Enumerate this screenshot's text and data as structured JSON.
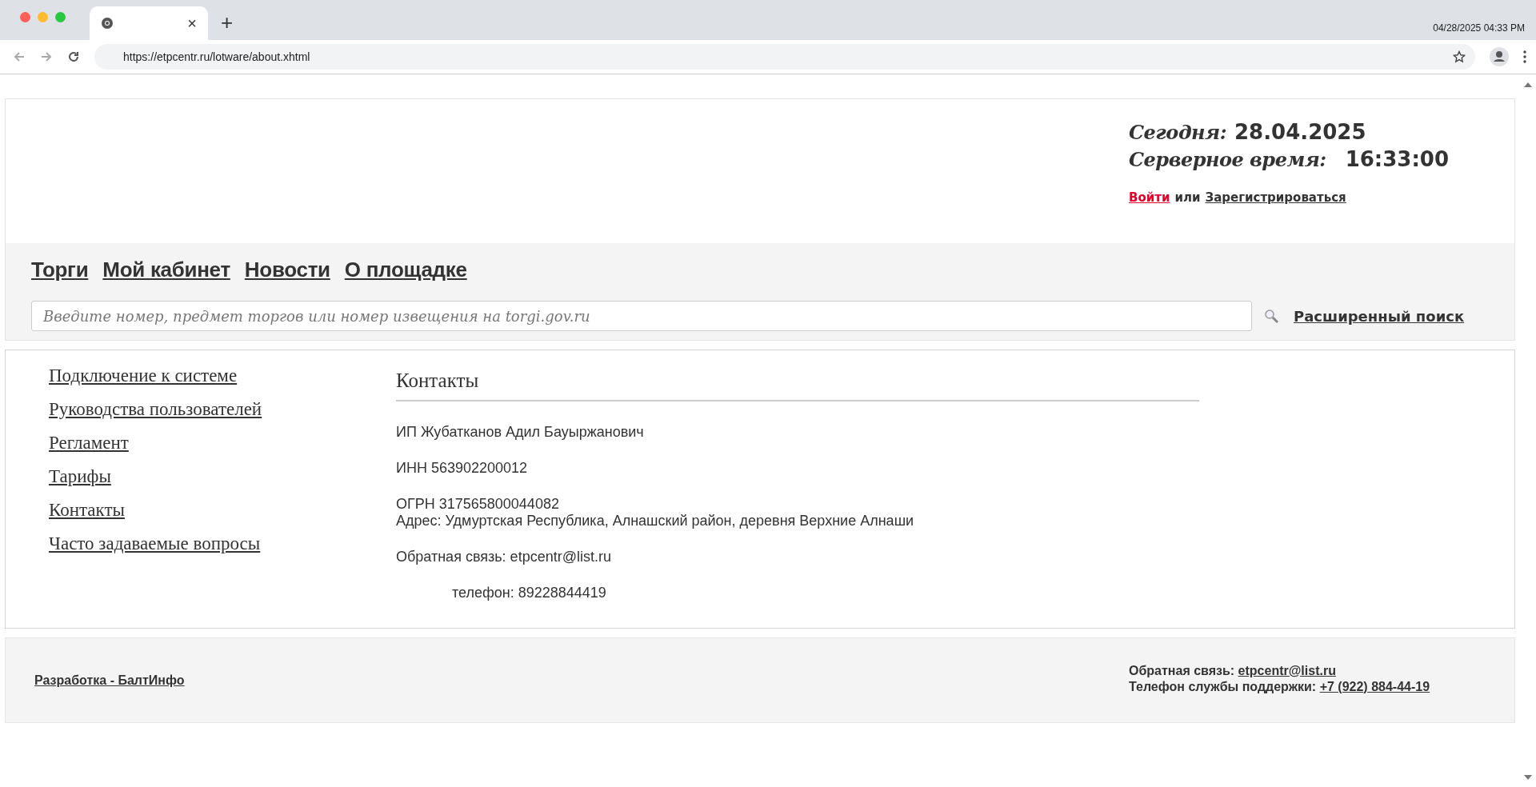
{
  "browser": {
    "tab_close": "×",
    "new_tab": "+",
    "timestamp": "04/28/2025 04:33 PM",
    "url": "https://etpcentr.ru/lotware/about.xhtml"
  },
  "header": {
    "today_label": "Сегодня:",
    "today_value": "28.04.2025",
    "time_label": "Серверное время:",
    "time_value": "16:33:00",
    "login": "Войти",
    "or": "или",
    "register": "Зарегистрироваться"
  },
  "nav": [
    "Торги",
    "Мой кабинет",
    "Новости",
    "О площадке"
  ],
  "search": {
    "placeholder": "Введите номер, предмет торгов или номер извещения на torgi.gov.ru",
    "advanced": "Расширенный поиск"
  },
  "sidebar": [
    "Подключение к системе",
    "Руководства пользователей",
    "Регламент",
    "Тарифы",
    "Контакты",
    "Часто задаваемые вопросы"
  ],
  "content": {
    "title": "Контакты",
    "paragraphs": [
      {
        "kind": "plain",
        "lines": [
          "ИП Жубатканов Адил Бауыржанович"
        ]
      },
      {
        "kind": "plain",
        "lines": [
          "ИНН 563902200012"
        ]
      },
      {
        "kind": "plain",
        "lines": [
          "ОГРН 317565800044082",
          "Адрес: Удмуртская Республика, Алнашский район, деревня Верхние Алнаши"
        ]
      },
      {
        "kind": "plain",
        "lines": [
          "Обратная связь: etpcentr@list.ru"
        ]
      },
      {
        "kind": "indented",
        "lines": [
          "телефон: 89228844419"
        ]
      }
    ]
  },
  "footer": {
    "credit": "Разработка - БалтИнфо",
    "feedback_label": "Обратная связь:",
    "feedback_email": "etpcentr@list.ru",
    "phone_label": "Телефон службы поддержки:",
    "phone_value": "+7 (922) 884-44-19"
  }
}
